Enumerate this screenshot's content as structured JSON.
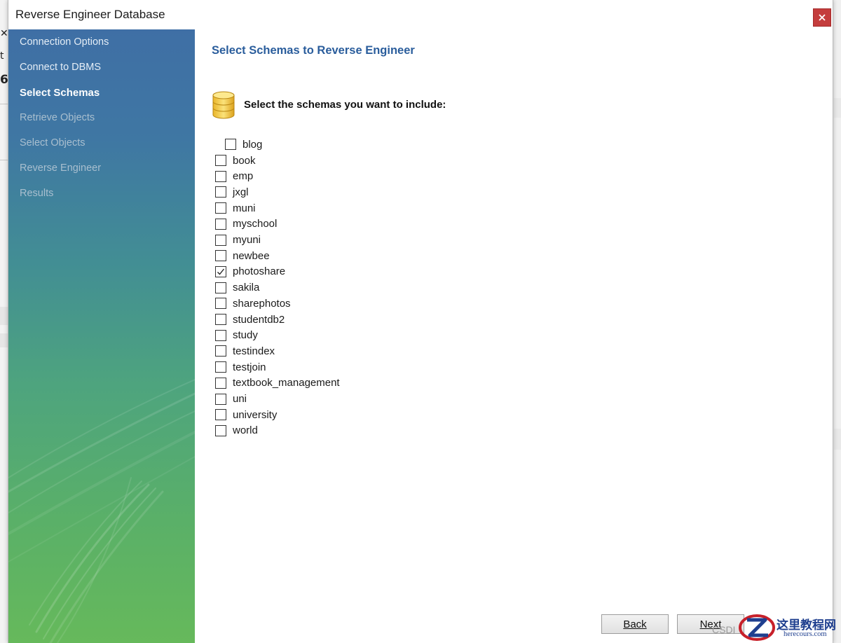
{
  "window": {
    "title": "Reverse Engineer Database"
  },
  "sidebar": {
    "items": [
      {
        "label": "Connection Options",
        "state": "done"
      },
      {
        "label": "Connect to DBMS",
        "state": "done"
      },
      {
        "label": "Select Schemas",
        "state": "current"
      },
      {
        "label": "Retrieve Objects",
        "state": "pending"
      },
      {
        "label": "Select Objects",
        "state": "pending"
      },
      {
        "label": "Reverse Engineer",
        "state": "pending"
      },
      {
        "label": "Results",
        "state": "pending"
      }
    ]
  },
  "main": {
    "title": "Select Schemas to Reverse Engineer",
    "prompt": "Select the schemas you want to include:",
    "schemas": [
      {
        "name": "blog",
        "checked": false
      },
      {
        "name": "book",
        "checked": false
      },
      {
        "name": "emp",
        "checked": false
      },
      {
        "name": "jxgl",
        "checked": false
      },
      {
        "name": "muni",
        "checked": false
      },
      {
        "name": "myschool",
        "checked": false
      },
      {
        "name": "myuni",
        "checked": false
      },
      {
        "name": "newbee",
        "checked": false
      },
      {
        "name": "photoshare",
        "checked": true
      },
      {
        "name": "sakila",
        "checked": false
      },
      {
        "name": "sharephotos",
        "checked": false
      },
      {
        "name": "studentdb2",
        "checked": false
      },
      {
        "name": "study",
        "checked": false
      },
      {
        "name": "testindex",
        "checked": false
      },
      {
        "name": "testjoin",
        "checked": false
      },
      {
        "name": "textbook_management",
        "checked": false
      },
      {
        "name": "uni",
        "checked": false
      },
      {
        "name": "university",
        "checked": false
      },
      {
        "name": "world",
        "checked": false
      }
    ]
  },
  "buttons": {
    "back": "Back",
    "next": "Next"
  },
  "background": {
    "fragment_1": "t",
    "fragment_2": "6"
  },
  "watermark": {
    "csdn": "CSDI",
    "site_cn": "这里教程网",
    "site_en": "herecours.com"
  },
  "colors": {
    "title_blue": "#2a5d9c",
    "close_red": "#c43d3d",
    "sidebar_top": "#3f6fa5",
    "sidebar_bottom": "#66b95b"
  }
}
